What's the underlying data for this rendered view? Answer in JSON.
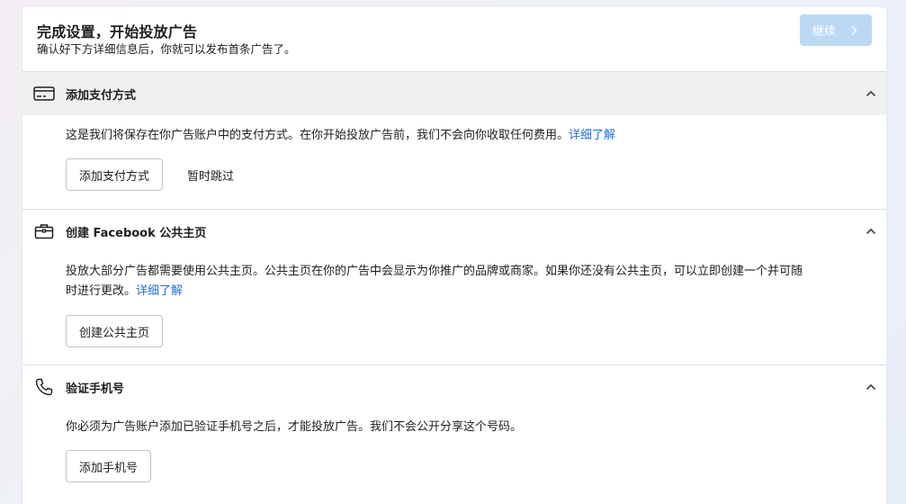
{
  "header": {
    "title": "完成设置，开始投放广告",
    "subtitle": "确认好下方详细信息后，你就可以发布首条广告了。",
    "continue_label": "继续"
  },
  "sections": [
    {
      "title": "添加支付方式",
      "icon": "credit-card-icon",
      "description": "这是我们将保存在你广告账户中的支付方式。在你开始投放广告前，我们不会向你收取任何费用。",
      "link": "详细了解",
      "primary_button": "添加支付方式",
      "secondary_button": "暂时跳过"
    },
    {
      "title": "创建 Facebook 公共主页",
      "icon": "briefcase-icon",
      "description": "投放大部分广告都需要使用公共主页。公共主页在你的广告中会显示为你推广的品牌或商家。如果你还没有公共主页，可以立即创建一个并可随时进行更改。",
      "link": "详细了解",
      "primary_button": "创建公共主页"
    },
    {
      "title": "验证手机号",
      "icon": "phone-icon",
      "description": "你必须为广告账户添加已验证手机号之后，才能投放广告。我们不会公开分享这个号码。",
      "primary_button": "添加手机号"
    }
  ]
}
